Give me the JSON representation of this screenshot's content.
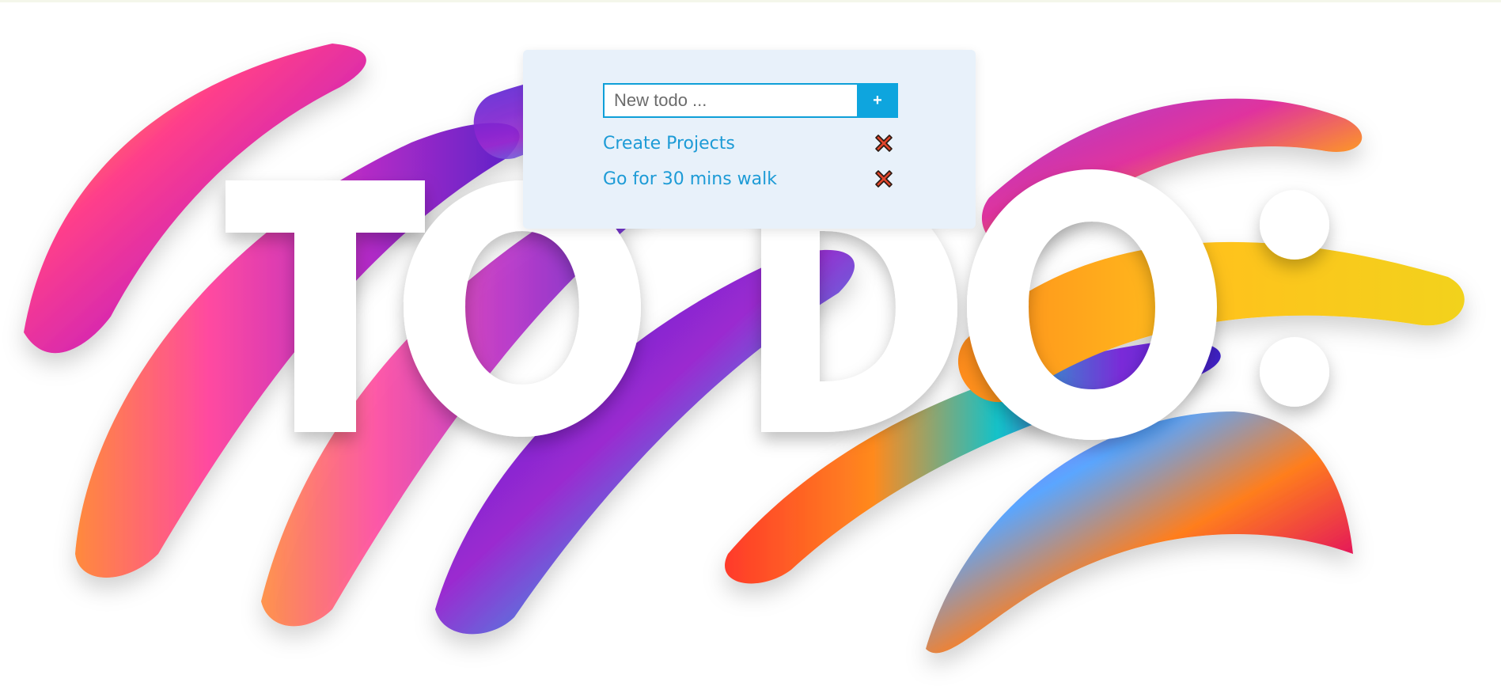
{
  "theme": {
    "card_background": "#e8f1fa",
    "accent": "#0ea5de",
    "item_text_color": "#1d9bd6",
    "delete_icon_color": "#e2452b"
  },
  "banner": {
    "image": "todo-banner",
    "lettering": "TO DO:"
  },
  "todo_form": {
    "input_value": "",
    "input_placeholder": "New todo ...",
    "add_button_label": "+"
  },
  "todos": [
    {
      "text": "Create Projects",
      "delete_icon": "close-x-icon"
    },
    {
      "text": "Go for 30 mins walk",
      "delete_icon": "close-x-icon"
    }
  ]
}
